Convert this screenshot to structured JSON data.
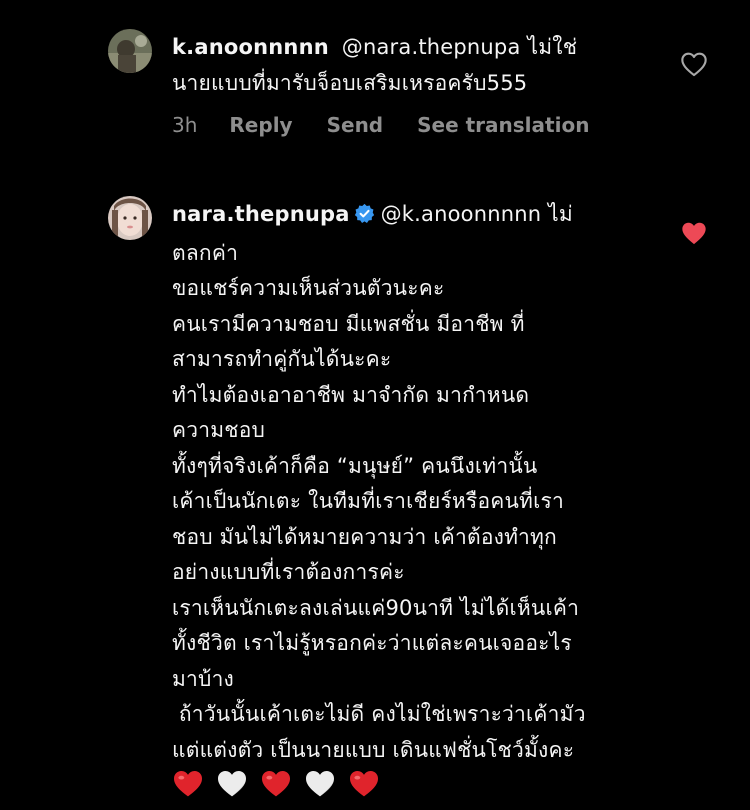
{
  "comment1": {
    "username": "k.anoonnnnn",
    "mention": "@nara.thepnupa",
    "text_line1": "ไม่ใช่",
    "text_line2": "นายแบบที่มารับจ็อบเสริมเหรอครับ555",
    "time": "3h",
    "reply_label": "Reply",
    "send_label": "Send",
    "translate_label": "See translation",
    "liked": false
  },
  "comment2": {
    "username": "nara.thepnupa",
    "verified": true,
    "mention": "@k.anoonnnnn",
    "first_word": "ไม่",
    "lines": [
      "ตลกค่า",
      "ขอแชร์ความเห็นส่วนตัวนะคะ",
      "คนเรามีความชอบ มีแพสชั่น มีอาชีพ ที่",
      "สามารถทำคู่กันได้นะคะ",
      "ทำไมต้องเอาอาชีพ มาจำกัด มากำหนด",
      "ความชอบ",
      "ทั้งๆที่จริงเค้าก็คือ “มนุษย์” คนนึงเท่านั้น",
      "เค้าเป็นนักเตะ ในทีมที่เราเชียร์หรือคนที่เรา",
      "ชอบ มันไม่ได้หมายความว่า เค้าต้องทำทุก",
      "อย่างแบบที่เราต้องการค่ะ",
      "เราเห็นนักเตะลงเล่นแค่90นาที ไม่ได้เห็นเค้า",
      "ทั้งชีวิต เราไม่รู้หรอกค่ะว่าแต่ละคนเจออะไร",
      "มาบ้าง",
      " ถ้าวันนั้นเค้าเตะไม่ดี คงไม่ใช่เพราะว่าเค้ามัว",
      "แต่แต่งตัว เป็นนายแบบ เดินแฟชั่นโชว์มั้งคะ"
    ],
    "emojis": [
      "red-heart",
      "white-heart",
      "red-heart",
      "white-heart",
      "red-heart"
    ],
    "liked": true
  },
  "colors": {
    "background": "#000000",
    "text": "#f5f5f5",
    "meta": "#8e8e8e",
    "like_red": "#ed4956",
    "verified_blue": "#3897f0"
  }
}
